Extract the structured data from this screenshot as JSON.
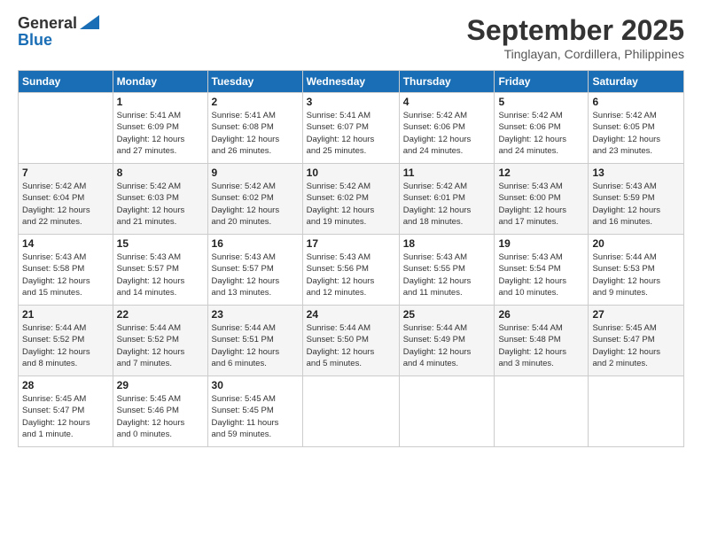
{
  "logo": {
    "line1": "General",
    "line2": "Blue"
  },
  "header": {
    "month": "September 2025",
    "location": "Tinglayan, Cordillera, Philippines"
  },
  "days_of_week": [
    "Sunday",
    "Monday",
    "Tuesday",
    "Wednesday",
    "Thursday",
    "Friday",
    "Saturday"
  ],
  "weeks": [
    [
      {
        "day": "",
        "info": ""
      },
      {
        "day": "1",
        "info": "Sunrise: 5:41 AM\nSunset: 6:09 PM\nDaylight: 12 hours\nand 27 minutes."
      },
      {
        "day": "2",
        "info": "Sunrise: 5:41 AM\nSunset: 6:08 PM\nDaylight: 12 hours\nand 26 minutes."
      },
      {
        "day": "3",
        "info": "Sunrise: 5:41 AM\nSunset: 6:07 PM\nDaylight: 12 hours\nand 25 minutes."
      },
      {
        "day": "4",
        "info": "Sunrise: 5:42 AM\nSunset: 6:06 PM\nDaylight: 12 hours\nand 24 minutes."
      },
      {
        "day": "5",
        "info": "Sunrise: 5:42 AM\nSunset: 6:06 PM\nDaylight: 12 hours\nand 24 minutes."
      },
      {
        "day": "6",
        "info": "Sunrise: 5:42 AM\nSunset: 6:05 PM\nDaylight: 12 hours\nand 23 minutes."
      }
    ],
    [
      {
        "day": "7",
        "info": "Sunrise: 5:42 AM\nSunset: 6:04 PM\nDaylight: 12 hours\nand 22 minutes."
      },
      {
        "day": "8",
        "info": "Sunrise: 5:42 AM\nSunset: 6:03 PM\nDaylight: 12 hours\nand 21 minutes."
      },
      {
        "day": "9",
        "info": "Sunrise: 5:42 AM\nSunset: 6:02 PM\nDaylight: 12 hours\nand 20 minutes."
      },
      {
        "day": "10",
        "info": "Sunrise: 5:42 AM\nSunset: 6:02 PM\nDaylight: 12 hours\nand 19 minutes."
      },
      {
        "day": "11",
        "info": "Sunrise: 5:42 AM\nSunset: 6:01 PM\nDaylight: 12 hours\nand 18 minutes."
      },
      {
        "day": "12",
        "info": "Sunrise: 5:43 AM\nSunset: 6:00 PM\nDaylight: 12 hours\nand 17 minutes."
      },
      {
        "day": "13",
        "info": "Sunrise: 5:43 AM\nSunset: 5:59 PM\nDaylight: 12 hours\nand 16 minutes."
      }
    ],
    [
      {
        "day": "14",
        "info": "Sunrise: 5:43 AM\nSunset: 5:58 PM\nDaylight: 12 hours\nand 15 minutes."
      },
      {
        "day": "15",
        "info": "Sunrise: 5:43 AM\nSunset: 5:57 PM\nDaylight: 12 hours\nand 14 minutes."
      },
      {
        "day": "16",
        "info": "Sunrise: 5:43 AM\nSunset: 5:57 PM\nDaylight: 12 hours\nand 13 minutes."
      },
      {
        "day": "17",
        "info": "Sunrise: 5:43 AM\nSunset: 5:56 PM\nDaylight: 12 hours\nand 12 minutes."
      },
      {
        "day": "18",
        "info": "Sunrise: 5:43 AM\nSunset: 5:55 PM\nDaylight: 12 hours\nand 11 minutes."
      },
      {
        "day": "19",
        "info": "Sunrise: 5:43 AM\nSunset: 5:54 PM\nDaylight: 12 hours\nand 10 minutes."
      },
      {
        "day": "20",
        "info": "Sunrise: 5:44 AM\nSunset: 5:53 PM\nDaylight: 12 hours\nand 9 minutes."
      }
    ],
    [
      {
        "day": "21",
        "info": "Sunrise: 5:44 AM\nSunset: 5:52 PM\nDaylight: 12 hours\nand 8 minutes."
      },
      {
        "day": "22",
        "info": "Sunrise: 5:44 AM\nSunset: 5:52 PM\nDaylight: 12 hours\nand 7 minutes."
      },
      {
        "day": "23",
        "info": "Sunrise: 5:44 AM\nSunset: 5:51 PM\nDaylight: 12 hours\nand 6 minutes."
      },
      {
        "day": "24",
        "info": "Sunrise: 5:44 AM\nSunset: 5:50 PM\nDaylight: 12 hours\nand 5 minutes."
      },
      {
        "day": "25",
        "info": "Sunrise: 5:44 AM\nSunset: 5:49 PM\nDaylight: 12 hours\nand 4 minutes."
      },
      {
        "day": "26",
        "info": "Sunrise: 5:44 AM\nSunset: 5:48 PM\nDaylight: 12 hours\nand 3 minutes."
      },
      {
        "day": "27",
        "info": "Sunrise: 5:45 AM\nSunset: 5:47 PM\nDaylight: 12 hours\nand 2 minutes."
      }
    ],
    [
      {
        "day": "28",
        "info": "Sunrise: 5:45 AM\nSunset: 5:47 PM\nDaylight: 12 hours\nand 1 minute."
      },
      {
        "day": "29",
        "info": "Sunrise: 5:45 AM\nSunset: 5:46 PM\nDaylight: 12 hours\nand 0 minutes."
      },
      {
        "day": "30",
        "info": "Sunrise: 5:45 AM\nSunset: 5:45 PM\nDaylight: 11 hours\nand 59 minutes."
      },
      {
        "day": "",
        "info": ""
      },
      {
        "day": "",
        "info": ""
      },
      {
        "day": "",
        "info": ""
      },
      {
        "day": "",
        "info": ""
      }
    ]
  ]
}
